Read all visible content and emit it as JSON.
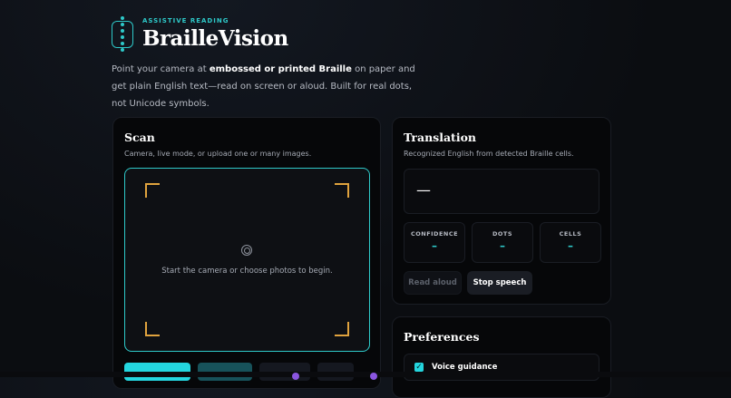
{
  "brand": {
    "eyebrow": "ASSISTIVE READING",
    "title": "BrailleVision",
    "accent_color": "#2ec9c9"
  },
  "intro": {
    "part1": "Point your camera at ",
    "bold": "embossed or printed Braille",
    "part2": " on paper and get plain English text—read on screen or aloud. Built for real dots, not Unicode symbols."
  },
  "scan": {
    "title": "Scan",
    "subtitle": "Camera, live mode, or upload one or many images.",
    "placeholder": "Start the camera or choose photos to begin.",
    "icon": "camera-target-icon"
  },
  "translation": {
    "title": "Translation",
    "subtitle": "Recognized English from detected Braille cells.",
    "output": "—",
    "stats": [
      {
        "label": "CONFIDENCE",
        "value": "–"
      },
      {
        "label": "DOTS",
        "value": "–"
      },
      {
        "label": "CELLS",
        "value": "–"
      }
    ],
    "read_aloud": "Read aloud",
    "stop_speech": "Stop speech"
  },
  "preferences": {
    "title": "Preferences",
    "voice_guidance": "Voice guidance",
    "voice_guidance_checked": true
  }
}
